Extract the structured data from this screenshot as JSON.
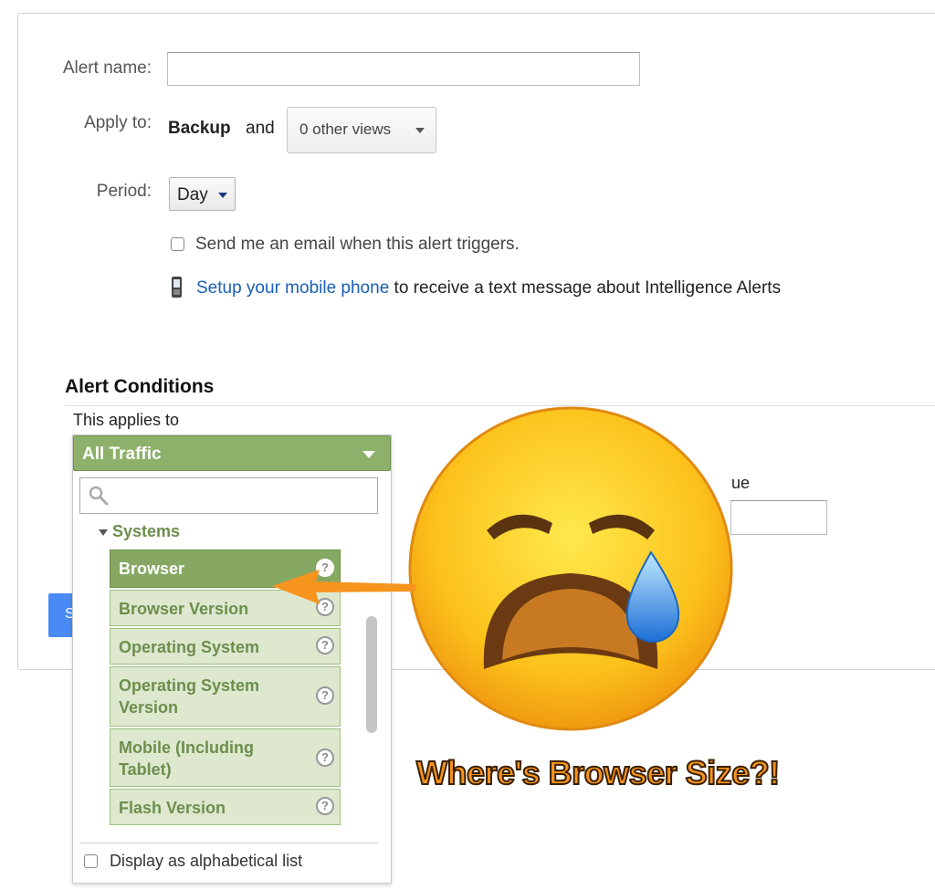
{
  "form": {
    "alert_name_label": "Alert name:",
    "alert_name_value": "",
    "apply_to_label": "Apply to:",
    "apply_to_view": "Backup",
    "apply_to_and": "and",
    "other_views_button": "0 other views",
    "period_label": "Period:",
    "period_value": "Day",
    "email_checkbox_label": "Send me an email when this alert triggers.",
    "mobile_link": "Setup your mobile phone",
    "mobile_text": "to receive a text message about Intelligence Alerts"
  },
  "conditions": {
    "heading": "Alert Conditions",
    "applies_to_label": "This applies to",
    "value_label_partial": "ue",
    "save_button_partial": "S"
  },
  "dropdown": {
    "selected": "All Traffic",
    "search_placeholder": "",
    "group_label": "Systems",
    "items": [
      {
        "label": "Browser",
        "selected": true
      },
      {
        "label": "Browser Version",
        "selected": false
      },
      {
        "label": "Operating System",
        "selected": false
      },
      {
        "label": "Operating System\nVersion",
        "selected": false
      },
      {
        "label": "Mobile (Including\nTablet)",
        "selected": false
      },
      {
        "label": "Flash Version",
        "selected": false
      }
    ],
    "help_glyph": "?",
    "alphabetical_label": "Display as alphabetical list"
  },
  "annotation": {
    "caption": "Where's Browser Size?!",
    "emoji": "crying-face-emoji",
    "arrow_color": "#f7941d"
  },
  "colors": {
    "accent_green": "#8db06a",
    "link_blue": "#1a5fb4",
    "button_blue": "#4a8af4"
  }
}
